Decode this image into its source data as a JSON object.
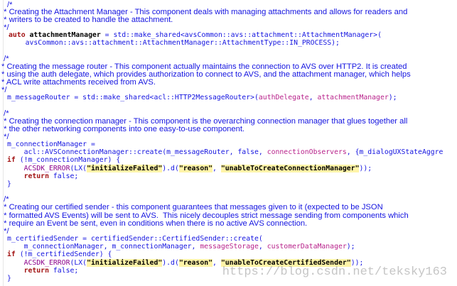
{
  "block1": {
    "c1": "/*",
    "c2": " * Creating the Attachment Manager - This component deals with managing attachments and allows for readers and",
    "c3": " * writers to be created to handle the attachment.",
    "c4": " */",
    "kw_auto": "auto",
    "var": "attachmentManager",
    "rhs": " = std::make_shared<avsCommon::avs::attachment::AttachmentManager>(",
    "arg": "    avsCommon::avs::attachment::AttachmentManager::AttachmentType::IN_PROCESS);"
  },
  "block2": {
    "c1": " /*",
    "c2": "* Creating the message router - This component actually maintains the connection to AVS over HTTP2. It is created",
    "c3": "* using the auth delegate, which provides authorization to connect to AVS, and the attachment manager, which helps",
    "c4": "* ACL write attachments received from AVS.",
    "c5": "*/",
    "code_a": "m_messageRouter = std::make_shared<acl::HTTP2MessageRouter>(",
    "p1": "authDelegate",
    "code_b": ", ",
    "p2": "attachmentManager",
    "code_c": ");"
  },
  "block3": {
    "c1": " /*",
    "c2": " * Creating the connection manager - This component is the overarching connection manager that glues together all",
    "c3": " * the other networking components into one easy-to-use component.",
    "c4": " */",
    "l1": "m_connectionManager =",
    "l2a": "    acl::AVSConnectionManager::create(m_messageRouter, false, ",
    "l2p1": "connectionObservers",
    "l2b": ", {m_dialogUXStateAggre",
    "if_kw": "if",
    "if_rest": " (!m_connectionManager) {",
    "macro": "    ACSDK_ERROR",
    "err_a": "(LX(",
    "s1": "\"initializeFailed\"",
    "err_b": ").d(",
    "s2": "\"reason\"",
    "err_c": ", ",
    "s3": "\"unableToCreateConnectionManager\"",
    "err_d": "));",
    "ret_kw": "    return",
    "ret_rest": " false;",
    "close": "}"
  },
  "block4": {
    "c1": " /*",
    "c2": " * Creating our certified sender - this component guarantees that messages given to it (expected to be JSON",
    "c3": " * formatted AVS Events) will be sent to AVS.  This nicely decouples strict message sending from components which",
    "c4": " * require an Event be sent, even in conditions when there is no active AVS connection.",
    "c5": " */",
    "l1": "m_certifiedSender = certifiedSender::CertifiedSender::create(",
    "l2a": "    m_connectionManager, m_connectionManager, ",
    "l2p1": "messageStorage",
    "l2b": ", ",
    "l2p2": "customerDataManager",
    "l2c": ");",
    "if_kw": "if",
    "if_rest": " (!m_certifiedSender) {",
    "macro": "    ACSDK_ERROR",
    "err_a": "(LX(",
    "s1": "\"initializeFailed\"",
    "err_b": ").d(",
    "s2": "\"reason\"",
    "err_c": ", ",
    "s3": "\"unableToCreateCertifiedSender\"",
    "err_d": "));",
    "ret_kw": "    return",
    "ret_rest": " false;",
    "close": "}"
  },
  "watermark": "https://blog.csdn.net/teksky163",
  "colors": {
    "comment": "#1414e0",
    "keyword": "#a31515",
    "macro": "#8b008b",
    "string_highlight": "#fff4a8",
    "parameter": "#b8238b"
  }
}
